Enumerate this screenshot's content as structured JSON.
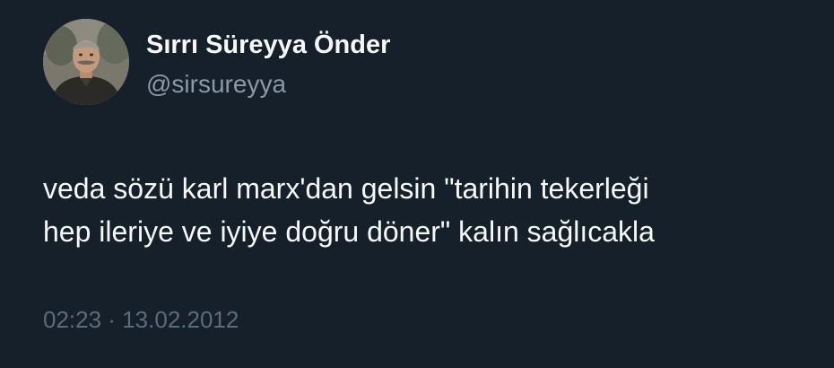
{
  "tweet": {
    "author": {
      "display_name": "Sırrı Süreyya Önder",
      "handle": "@sirsureyya",
      "avatar_icon": "profile-photo"
    },
    "text_lines": [
      "veda sözü karl marx'dan gelsin \"tarihin tekerleği",
      "hep ileriye ve iyiye doğru döner\" kalın sağlıcakla"
    ],
    "time": "02:23",
    "separator": "·",
    "date": "13.02.2012"
  },
  "colors": {
    "background": "#15202b",
    "primary_text": "#f7f9f9",
    "secondary_text": "#8b98a5",
    "meta_text": "#5c6b79"
  }
}
